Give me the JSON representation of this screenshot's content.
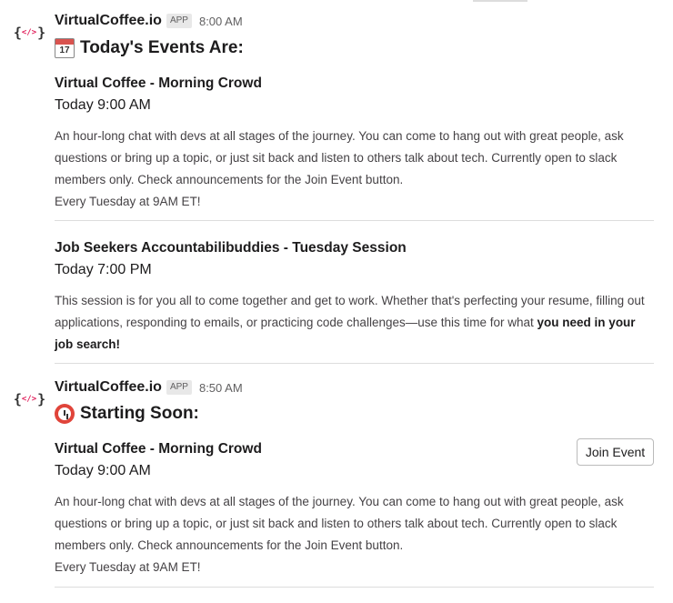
{
  "messages": [
    {
      "sender": "VirtualCoffee.io",
      "badge": "APP",
      "time": "8:00 AM",
      "avatar_left": "{",
      "avatar_tag": "</>",
      "avatar_right": "}",
      "heading_icon": "calendar-icon",
      "heading_icon_text": "17",
      "heading": "Today's Events Are:",
      "events": [
        {
          "title": "Virtual Coffee - Morning Crowd",
          "time": "Today 9:00 AM",
          "description": "An hour-long chat with devs at all stages of the journey. You can come to hang out with great people, ask questions or bring up a topic, or just sit back and listen to others talk about tech. Currently open to slack members only. Check announcements for the Join Event button.",
          "recurrence": "Every Tuesday at 9AM ET!"
        },
        {
          "title": "Job Seekers Accountabilibuddies - Tuesday Session",
          "time": "Today 7:00 PM",
          "description": "This session is for you all to come together and get to work. Whether that's perfecting your resume, filling out applications, responding to emails, or practicing code challenges—use this time for what",
          "description_bold": "you need in your job search!"
        }
      ]
    },
    {
      "sender": "VirtualCoffee.io",
      "badge": "APP",
      "time": "8:50 AM",
      "avatar_left": "{",
      "avatar_tag": "</>",
      "avatar_right": "}",
      "heading_icon": "alarm-clock-icon",
      "heading": "Starting Soon:",
      "events": [
        {
          "title": "Virtual Coffee - Morning Crowd",
          "time": "Today 9:00 AM",
          "button": "Join Event",
          "description": "An hour-long chat with devs at all stages of the journey. You can come to hang out with great people, ask questions or bring up a topic, or just sit back and listen to others talk about tech. Currently open to slack members only. Check announcements for the Join Event button.",
          "recurrence": "Every Tuesday at 9AM ET!"
        }
      ]
    }
  ]
}
